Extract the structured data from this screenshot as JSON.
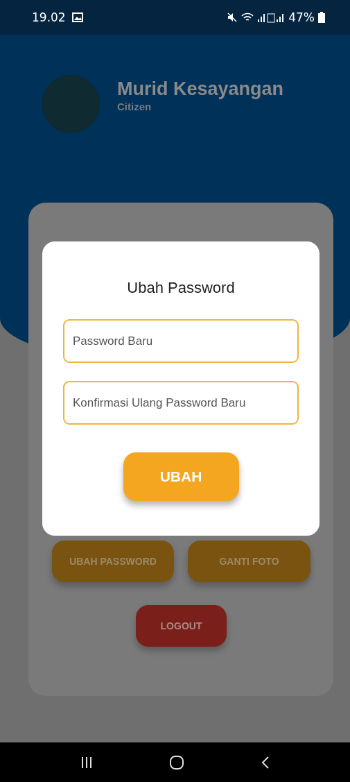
{
  "status_bar": {
    "time": "19.02",
    "battery": "47%"
  },
  "profile": {
    "name": "Murid Kesayangan",
    "role": "Citizen"
  },
  "actions": [
    {
      "label": "UBAH PASSWORD",
      "kind": "primary"
    },
    {
      "label": "GANTI FOTO",
      "kind": "primary"
    },
    {
      "label": "LOGOUT",
      "kind": "danger"
    }
  ],
  "dialog": {
    "title": "Ubah Password",
    "fields": [
      {
        "placeholder": "Password Baru"
      },
      {
        "placeholder": "Konfirmasi Ulang Password Baru"
      }
    ],
    "submit": "UBAH"
  }
}
